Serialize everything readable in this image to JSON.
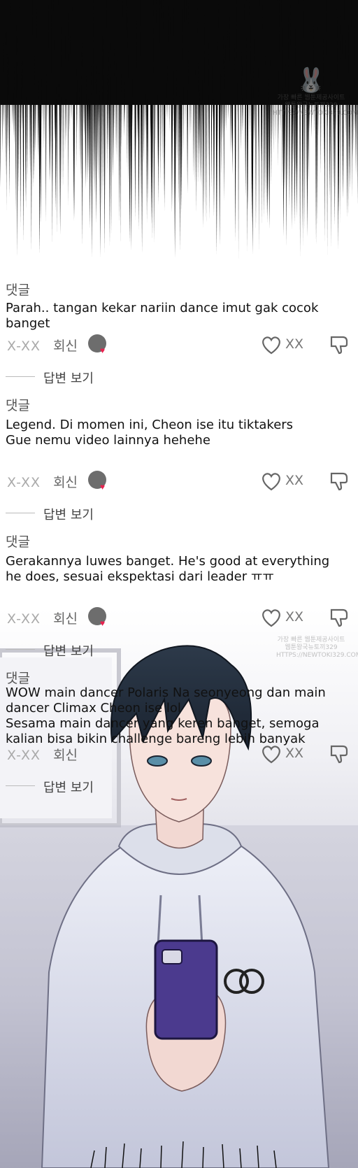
{
  "header_label": "댓글",
  "comments": [
    {
      "header": "댓글",
      "text": "Parah.. tangan kekar nariin dance imut gak cocok banget",
      "meta_x": "X-XX",
      "meta_reply": "회신",
      "likes": "XX",
      "view_replies": "답변 보기"
    },
    {
      "header": "댓글",
      "text_line1": "Legend. Di momen ini, Cheon ise itu tiktakers",
      "text_line2": "Gue nemu video lainnya hehehe",
      "meta_x": "X-XX",
      "meta_reply": "회신",
      "likes": "XX",
      "view_replies": "답변 보기"
    },
    {
      "header": "댓글",
      "text_line1": "Gerakannya luwes banget. He's good at everything",
      "text_line2": "he does, sesuai ekspektasi dari leader ㅠㅠ",
      "meta_x": "X-XX",
      "meta_reply": "회신",
      "likes": "XX",
      "view_replies": "답변 보기"
    },
    {
      "header": "댓글",
      "text_line1": "WOW main dancer Polaris Na seonyeong dan main",
      "text_line2": "dancer Climax Cheon ise lol",
      "text_line3": "Sesama main dancer yang keren banget, semoga",
      "text_line4": "kalian bisa bikin challenge bareng lebih banyak",
      "meta_x": "X-XX",
      "meta_reply": "회신",
      "likes": "XX",
      "view_replies": "답변 보기"
    }
  ],
  "watermark": {
    "line1": "가장 빠른 웹툰제공사이트",
    "line2": "웹툰왕국뉴토끼329",
    "line3": "HTTPS://NEWTOKI329.COM"
  },
  "colors": {
    "heart_dot": "#e8224f",
    "meta_gray": "#888888",
    "avatar": "#6d6d6d"
  }
}
